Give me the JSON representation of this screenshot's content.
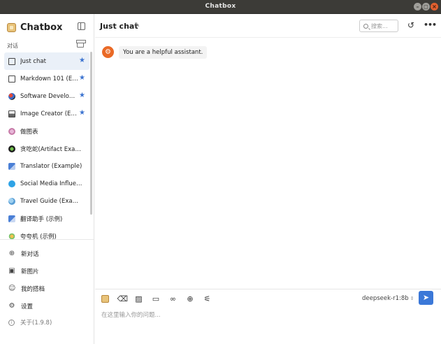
{
  "window": {
    "title": "Chatbox",
    "controls": [
      "–",
      "◻",
      "×"
    ]
  },
  "sidebar": {
    "app_name": "Chatbox",
    "section_label": "对话",
    "chats": [
      {
        "label": "Just chat",
        "icon": "chat-bubble-icon",
        "starred": true,
        "active": true
      },
      {
        "label": "Markdown 101 (E…",
        "icon": "chat-bubble-icon",
        "starred": true
      },
      {
        "label": "Software Develo…",
        "icon": "developer-avatar-icon",
        "starred": true
      },
      {
        "label": "Image Creator (E…",
        "icon": "image-icon",
        "starred": true
      },
      {
        "label": "做图表",
        "icon": "chart-avatar-icon",
        "starred": false
      },
      {
        "label": "贪吃蛇(Artifact Example)",
        "icon": "snake-avatar-icon",
        "starred": false
      },
      {
        "label": "Translator (Example)",
        "icon": "translator-avatar-icon",
        "starred": false
      },
      {
        "label": "Social Media Influenc…",
        "icon": "twitter-avatar-icon",
        "starred": false
      },
      {
        "label": "Travel Guide (Example)",
        "icon": "globe-avatar-icon",
        "starred": false
      },
      {
        "label": "翻译助手 (示例)",
        "icon": "translate-avatar-icon",
        "starred": false
      },
      {
        "label": "夸夸机 (示例)",
        "icon": "praise-avatar-icon",
        "starred": false
      }
    ],
    "star_glyph": "★",
    "menu": [
      {
        "label": "新对话",
        "icon": "plus-circle-icon",
        "glyph": "⊕"
      },
      {
        "label": "新图片",
        "icon": "image-icon",
        "glyph": "▣"
      },
      {
        "label": "我的搭档",
        "icon": "robot-icon",
        "glyph": "☺"
      },
      {
        "label": "设置",
        "icon": "gear-icon",
        "glyph": "⚙"
      }
    ],
    "version": "关于(1.9.8)"
  },
  "header": {
    "title": "Just chat",
    "edit_glyph": "✎",
    "search_placeholder": "搜索...",
    "history_glyph": "↺",
    "more_glyph": "•••"
  },
  "messages": [
    {
      "role": "system",
      "avatar_glyph": "⚙",
      "text": "You are a helpful assistant."
    }
  ],
  "composer": {
    "tools": [
      {
        "name": "chatbox-logo-tool",
        "glyph": ""
      },
      {
        "name": "eraser-icon",
        "glyph": "⌫"
      },
      {
        "name": "image-upload-icon",
        "glyph": "▨"
      },
      {
        "name": "folder-icon",
        "glyph": "▭"
      },
      {
        "name": "link-icon",
        "glyph": "∞"
      },
      {
        "name": "globe-icon",
        "glyph": "⊕"
      },
      {
        "name": "settings-sliders-icon",
        "glyph": "⚟"
      }
    ],
    "model": "deepseek-r1:8b",
    "model_chevron": "⇕",
    "send_glyph": "➤",
    "placeholder": "在这里输入你的问题..."
  },
  "colors": {
    "accent": "#3b78d8",
    "star": "#3b73d0",
    "system_avatar": "#ea6a26",
    "active_row": "#eaf0f8"
  }
}
